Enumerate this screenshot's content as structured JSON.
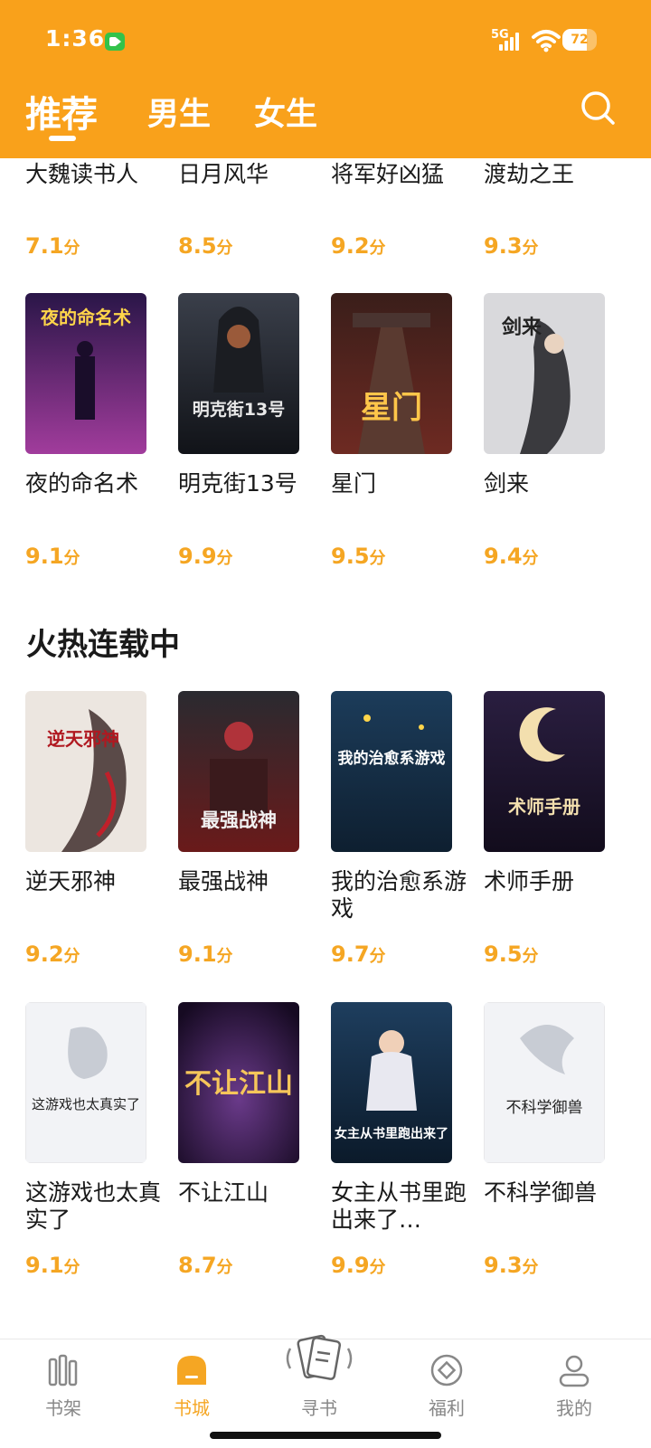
{
  "status_bar": {
    "time": "1:36",
    "network": "5G",
    "battery": "72",
    "battery_level": 0.72
  },
  "header": {
    "tabs": [
      {
        "label": "推荐",
        "active": true
      },
      {
        "label": "男生",
        "active": false
      },
      {
        "label": "女生",
        "active": false
      }
    ],
    "search_icon": "search-icon"
  },
  "colors": {
    "accent": "#F9A11B",
    "score": "#F5A623"
  },
  "score_unit": "分",
  "row0": [
    {
      "title": "大魏读书人",
      "score": "7.1"
    },
    {
      "title": "日月风华",
      "score": "8.5"
    },
    {
      "title": "将军好凶猛",
      "score": "9.2"
    },
    {
      "title": "渡劫之王",
      "score": "9.3"
    }
  ],
  "row1": [
    {
      "title": "夜的命名术",
      "score": "9.1",
      "cover_text": "夜的命名术"
    },
    {
      "title": "明克街13号",
      "score": "9.9",
      "cover_text": "明克街13号"
    },
    {
      "title": "星门",
      "score": "9.5",
      "cover_text": "星门"
    },
    {
      "title": "剑来",
      "score": "9.4",
      "cover_text": "剑来"
    }
  ],
  "section2": {
    "title": "火热连载中",
    "row2": [
      {
        "title": "逆天邪神",
        "score": "9.2",
        "cover_text": "逆天邪神"
      },
      {
        "title": "最强战神",
        "score": "9.1",
        "cover_text": "最强战神"
      },
      {
        "title": "我的治愈系游戏",
        "score": "9.7",
        "cover_text": "我的治愈系游戏"
      },
      {
        "title": "术师手册",
        "score": "9.5",
        "cover_text": "术师手册"
      }
    ],
    "row3": [
      {
        "title": "这游戏也太真实了",
        "score": "9.1",
        "cover_text": "这游戏也太真实了"
      },
      {
        "title": "不让江山",
        "score": "8.7",
        "cover_text": "不让江山"
      },
      {
        "title": "女主从书里跑出来了…",
        "score": "9.9",
        "cover_text": "女主从书里跑出来了"
      },
      {
        "title": "不科学御兽",
        "score": "9.3",
        "cover_text": "不科学御兽"
      }
    ]
  },
  "bottom_nav": [
    {
      "label": "书架",
      "icon": "bookshelf-icon"
    },
    {
      "label": "书城",
      "icon": "bookstore-icon",
      "active": true
    },
    {
      "label": "寻书",
      "icon": "find-book-icon"
    },
    {
      "label": "福利",
      "icon": "welfare-icon"
    },
    {
      "label": "我的",
      "icon": "profile-icon"
    }
  ]
}
